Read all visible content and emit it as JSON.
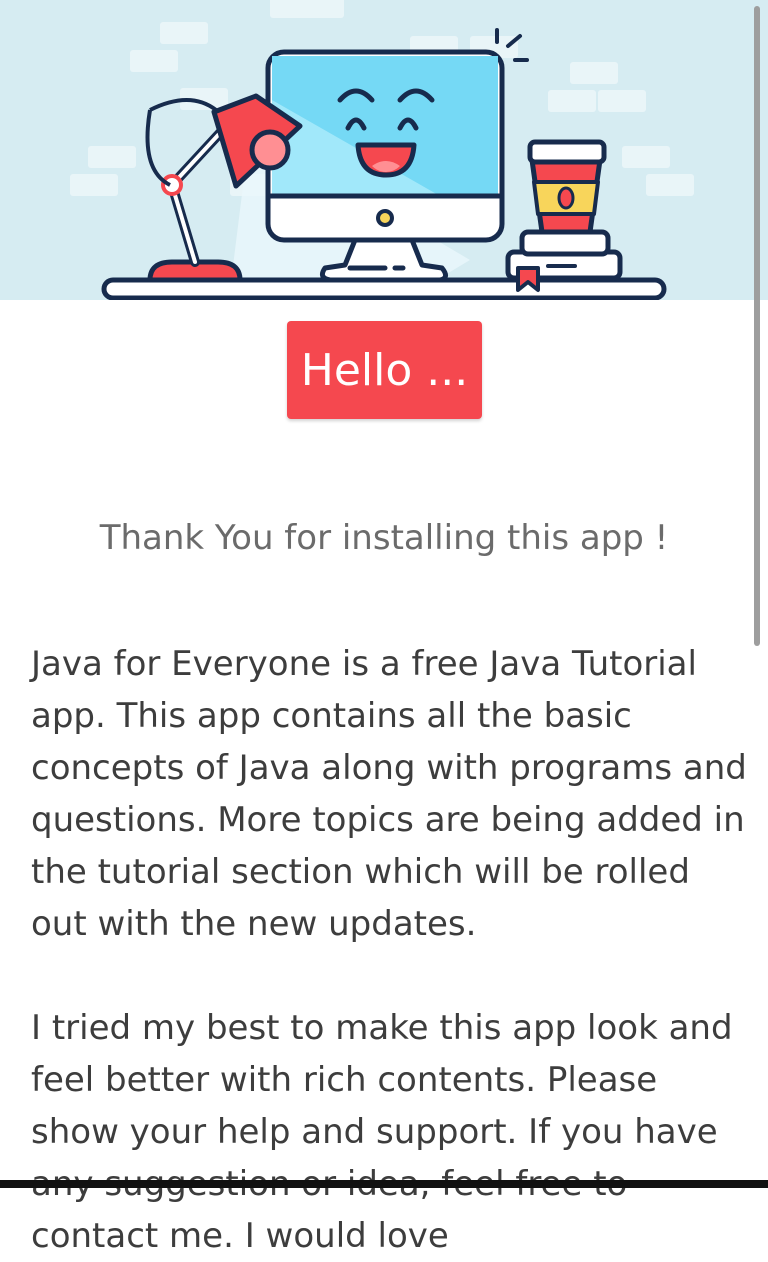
{
  "hero": {
    "illustration": "desk-computer-illustration"
  },
  "button": {
    "label": "Hello ..."
  },
  "thanks_text": "Thank You for installing this app !",
  "paragraphs": [
    "Java for Everyone is a free Java Tutorial app. This app contains all the basic concepts of Java along with programs and questions. More topics are being added in the tutorial section which will be rolled out with the new updates.",
    "I tried my best to make this app look and feel better with rich contents. Please show your help and support. If you have any suggestion or idea, feel free to contact me. I would love"
  ],
  "colors": {
    "hero_bg": "#d6ecf2",
    "accent_button": "#f5484f",
    "monitor_screen": "#75d9f5"
  }
}
